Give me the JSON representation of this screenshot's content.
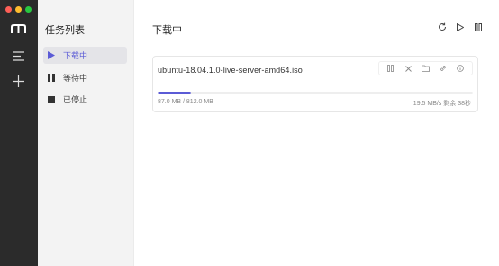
{
  "sidebar": {
    "title": "任务列表",
    "items": [
      {
        "label": "下载中",
        "icon": "play-icon"
      },
      {
        "label": "等待中",
        "icon": "pause-icon"
      },
      {
        "label": "已停止",
        "icon": "stop-icon"
      }
    ]
  },
  "main": {
    "title": "下载中",
    "toolbar": [
      "refresh-icon",
      "play-icon",
      "pause-icon"
    ]
  },
  "task": {
    "name": "ubuntu-18.04.1.0-live-server-amd64.iso",
    "size_text": "87.0 MB / 812.0 MB",
    "speed_text": "19.5 MB/s 剩余 38秒",
    "progress": 0.107,
    "actions": [
      "pause-icon",
      "close-icon",
      "folder-icon",
      "link-icon",
      "info-icon"
    ]
  },
  "colors": {
    "accent": "#5b5bd6",
    "rail": "#2b2b2b",
    "sidebar": "#f3f3f3"
  }
}
